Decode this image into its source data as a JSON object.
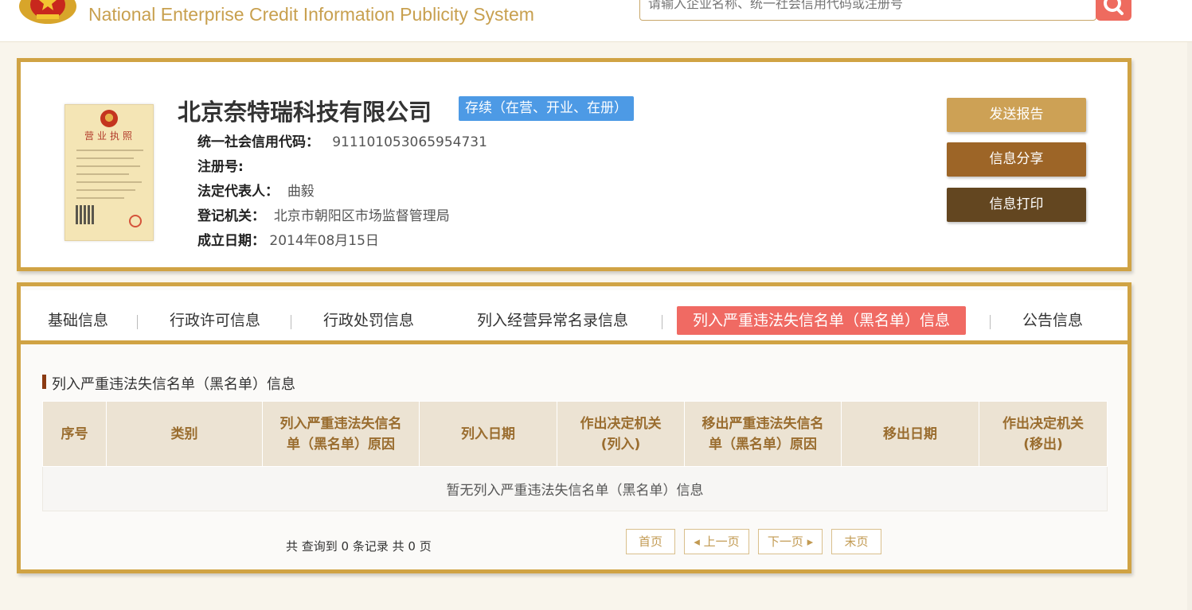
{
  "header": {
    "site_title": "National Enterprise Credit Information Publicity System",
    "search_placeholder": "请输入企业名称、统一社会信用代码或注册号"
  },
  "company": {
    "name": "北京奈特瑞科技有限公司",
    "status": "存续（在营、开业、在册）",
    "license_title": "营业执照",
    "fields": [
      {
        "label": "统一社会信用代码：",
        "value": "911101053065954731"
      },
      {
        "label": "注册号:",
        "value": ""
      },
      {
        "label": "法定代表人：",
        "value": "曲毅"
      },
      {
        "label": "登记机关：",
        "value": "北京市朝阳区市场监督管理局"
      },
      {
        "label": "成立日期：",
        "value": "2014年08月15日"
      }
    ],
    "actions": {
      "send_report": "发送报告",
      "share": "信息分享",
      "print": "信息打印"
    }
  },
  "tabs": [
    {
      "label": "基础信息"
    },
    {
      "label": "行政许可信息"
    },
    {
      "label": "行政处罚信息"
    },
    {
      "label": "列入经营异常名录信息"
    },
    {
      "label": "列入严重违法失信名单（黑名单）信息"
    },
    {
      "label": "公告信息"
    }
  ],
  "section": {
    "title": "列入严重违法失信名单（黑名单）信息",
    "columns": [
      {
        "line1": "序号",
        "line2": ""
      },
      {
        "line1": "类别",
        "line2": ""
      },
      {
        "line1": "列入严重违法失信名",
        "line2": "单（黑名单）原因"
      },
      {
        "line1": "列入日期",
        "line2": ""
      },
      {
        "line1": "作出决定机关",
        "line2": "(列入)"
      },
      {
        "line1": "移出严重违法失信名",
        "line2": "单（黑名单）原因"
      },
      {
        "line1": "移出日期",
        "line2": ""
      },
      {
        "line1": "作出决定机关",
        "line2": "(移出)"
      }
    ],
    "empty_message": "暂无列入严重违法失信名单（黑名单）信息"
  },
  "pagination": {
    "summary": "共 查询到 0 条记录 共 0 页",
    "first": "首页",
    "prev": "◂ 上一页",
    "next": "下一页 ▸",
    "last": "末页"
  },
  "colors": {
    "gold": "#d0a344",
    "status_blue": "#4d9ae5",
    "active_tab": "#f06a63",
    "btn_send": "#cda155",
    "btn_share": "#9d6527",
    "btn_print": "#634620"
  }
}
